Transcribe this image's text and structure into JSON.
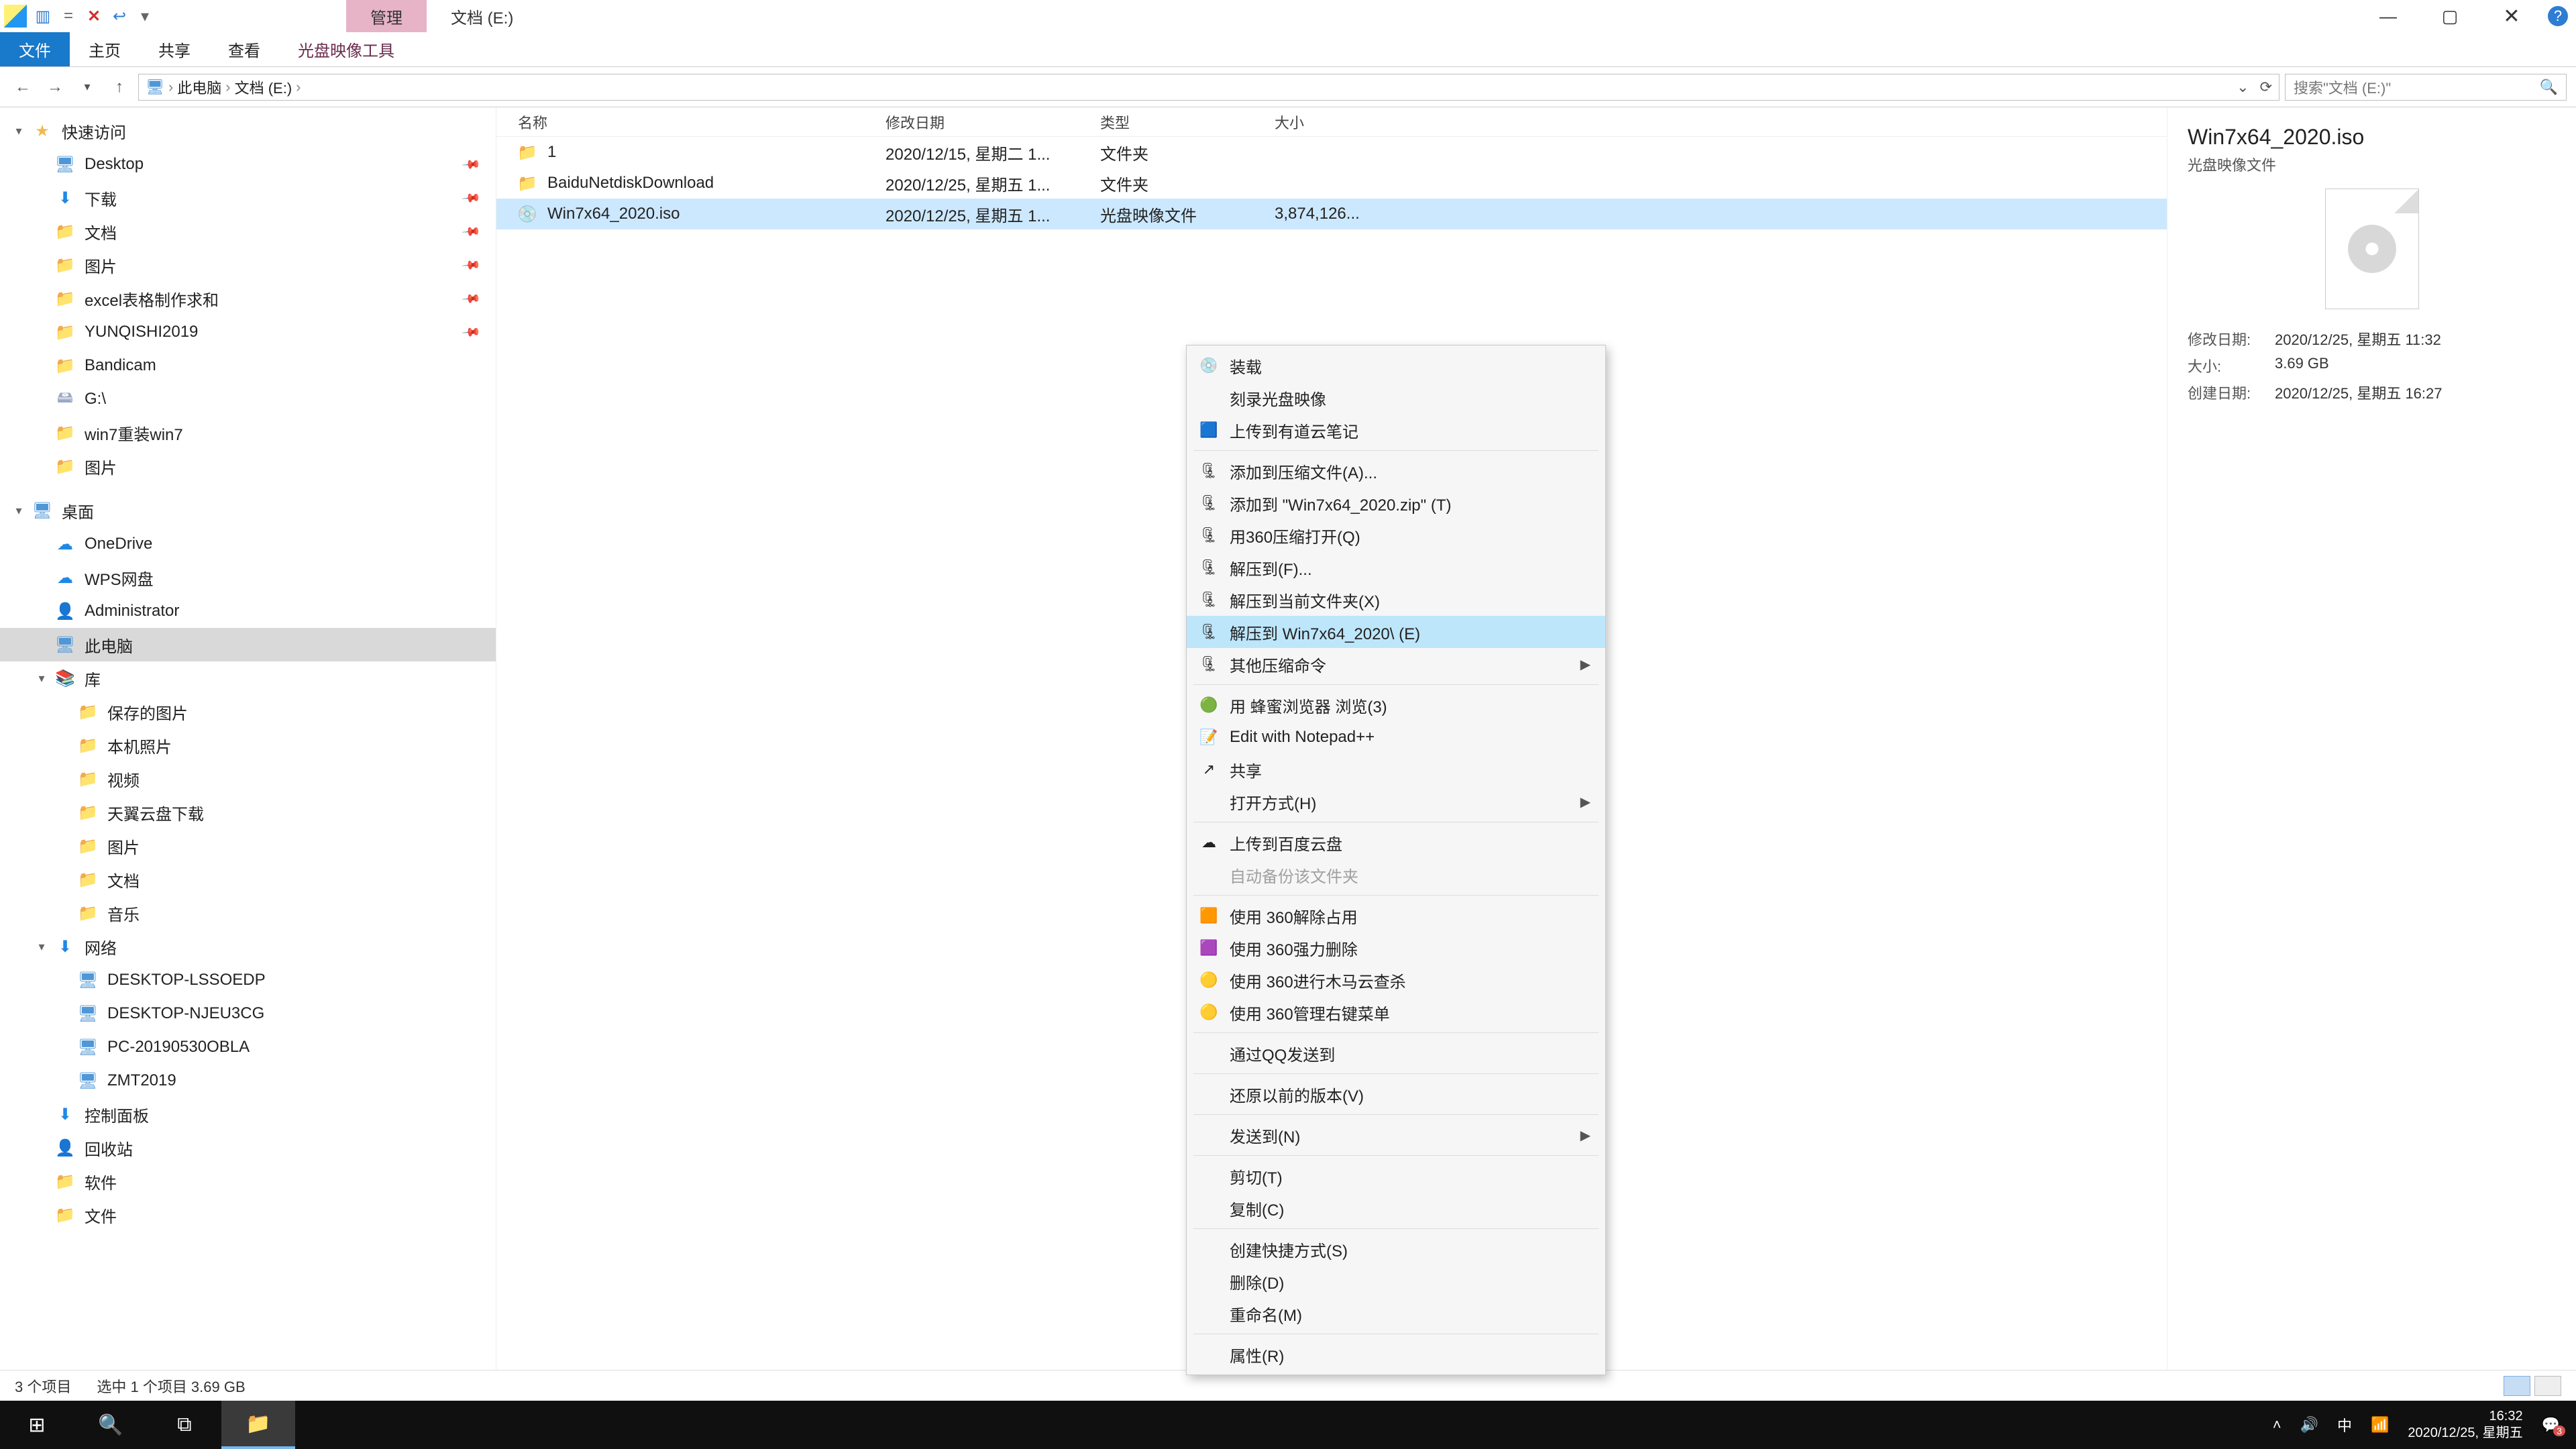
{
  "window": {
    "title_tabs": {
      "manage": "管理",
      "loc": "文档 (E:)"
    },
    "controls": {
      "min": "—",
      "max": "▢",
      "close": "✕",
      "help": "?"
    }
  },
  "qat": {
    "save_x": "✕",
    "undo": "↩",
    "redo": "▾",
    "eq": "="
  },
  "ribbon": {
    "file_tab": "文件",
    "tabs": [
      "主页",
      "共享",
      "查看"
    ],
    "contextual": "光盘映像工具"
  },
  "nav": {
    "back": "←",
    "fwd": "→",
    "recent": "▾",
    "up": "↑",
    "crumbs": [
      "此电脑",
      "文档 (E:)"
    ],
    "addr_chev": "›",
    "refresh": "⟳",
    "search_placeholder": "搜索\"文档 (E:)\"",
    "search_icon": "🔍"
  },
  "sidebar": [
    {
      "d": 0,
      "icon": "star",
      "label": "快速访问",
      "exp": "▾"
    },
    {
      "d": 1,
      "icon": "screen",
      "label": "Desktop",
      "pin": true
    },
    {
      "d": 1,
      "icon": "blue",
      "label": "下载",
      "pin": true
    },
    {
      "d": 1,
      "icon": "folder",
      "label": "文档",
      "pin": true
    },
    {
      "d": 1,
      "icon": "folder",
      "label": "图片",
      "pin": true
    },
    {
      "d": 1,
      "icon": "folder",
      "label": "excel表格制作求和",
      "pin": true
    },
    {
      "d": 1,
      "icon": "folder",
      "label": "YUNQISHI2019",
      "pin": true
    },
    {
      "d": 1,
      "icon": "folder",
      "label": "Bandicam"
    },
    {
      "d": 1,
      "icon": "drive",
      "label": "G:\\"
    },
    {
      "d": 1,
      "icon": "folder",
      "label": "win7重装win7"
    },
    {
      "d": 1,
      "icon": "folder",
      "label": "图片"
    },
    {
      "d": 0,
      "icon": "screen",
      "label": "桌面",
      "exp": "▾",
      "mtop": true
    },
    {
      "d": 1,
      "icon": "cloud",
      "label": "OneDrive"
    },
    {
      "d": 1,
      "icon": "cloud",
      "label": "WPS网盘"
    },
    {
      "d": 1,
      "icon": "grey",
      "label": "Administrator"
    },
    {
      "d": 1,
      "icon": "screen",
      "label": "此电脑",
      "sel": true
    },
    {
      "d": 1,
      "icon": "green",
      "label": "库",
      "exp": "▾"
    },
    {
      "d": 2,
      "icon": "folder",
      "label": "保存的图片"
    },
    {
      "d": 2,
      "icon": "folder",
      "label": "本机照片"
    },
    {
      "d": 2,
      "icon": "folder",
      "label": "视频"
    },
    {
      "d": 2,
      "icon": "folder",
      "label": "天翼云盘下载"
    },
    {
      "d": 2,
      "icon": "folder",
      "label": "图片"
    },
    {
      "d": 2,
      "icon": "folder",
      "label": "文档"
    },
    {
      "d": 2,
      "icon": "folder",
      "label": "音乐"
    },
    {
      "d": 1,
      "icon": "blue",
      "label": "网络",
      "exp": "▾"
    },
    {
      "d": 2,
      "icon": "screen",
      "label": "DESKTOP-LSSOEDP"
    },
    {
      "d": 2,
      "icon": "screen",
      "label": "DESKTOP-NJEU3CG"
    },
    {
      "d": 2,
      "icon": "screen",
      "label": "PC-20190530OBLA"
    },
    {
      "d": 2,
      "icon": "screen",
      "label": "ZMT2019"
    },
    {
      "d": 1,
      "icon": "blue",
      "label": "控制面板"
    },
    {
      "d": 1,
      "icon": "grey",
      "label": "回收站"
    },
    {
      "d": 1,
      "icon": "folder",
      "label": "软件"
    },
    {
      "d": 1,
      "icon": "folder",
      "label": "文件"
    }
  ],
  "cols": {
    "name": "名称",
    "date": "修改日期",
    "type": "类型",
    "size": "大小"
  },
  "rows": [
    {
      "icon": "folder",
      "name": "1",
      "date": "2020/12/15, 星期二 1...",
      "type": "文件夹",
      "size": ""
    },
    {
      "icon": "folder",
      "name": "BaiduNetdiskDownload",
      "date": "2020/12/25, 星期五 1...",
      "type": "文件夹",
      "size": ""
    },
    {
      "icon": "iso",
      "name": "Win7x64_2020.iso",
      "date": "2020/12/25, 星期五 1...",
      "type": "光盘映像文件",
      "size": "3,874,126...",
      "sel": true
    }
  ],
  "details": {
    "title": "Win7x64_2020.iso",
    "sub": "光盘映像文件",
    "mdate_k": "修改日期:",
    "mdate_v": "2020/12/25, 星期五 11:32",
    "size_k": "大小:",
    "size_v": "3.69 GB",
    "cdate_k": "创建日期:",
    "cdate_v": "2020/12/25, 星期五 16:27"
  },
  "ctx": [
    {
      "t": "装载",
      "ico": "disc"
    },
    {
      "t": "刻录光盘映像"
    },
    {
      "t": "上传到有道云笔记",
      "ico": "blue"
    },
    {
      "sep": true
    },
    {
      "t": "添加到压缩文件(A)...",
      "ico": "zip"
    },
    {
      "t": "添加到 \"Win7x64_2020.zip\" (T)",
      "ico": "zip"
    },
    {
      "t": "用360压缩打开(Q)",
      "ico": "zip"
    },
    {
      "t": "解压到(F)...",
      "ico": "zip"
    },
    {
      "t": "解压到当前文件夹(X)",
      "ico": "zip"
    },
    {
      "t": "解压到 Win7x64_2020\\ (E)",
      "ico": "zip",
      "hover": true
    },
    {
      "t": "其他压缩命令",
      "ico": "zip",
      "sub": true
    },
    {
      "sep": true
    },
    {
      "t": "用 蜂蜜浏览器 浏览(3)",
      "ico": "green"
    },
    {
      "t": "Edit with Notepad++",
      "ico": "npp"
    },
    {
      "t": "共享",
      "ico": "share"
    },
    {
      "t": "打开方式(H)",
      "sub": true
    },
    {
      "sep": true
    },
    {
      "t": "上传到百度云盘",
      "ico": "cloud"
    },
    {
      "t": "自动备份该文件夹",
      "disabled": true
    },
    {
      "sep": true
    },
    {
      "t": "使用 360解除占用",
      "ico": "sq"
    },
    {
      "t": "使用 360强力删除",
      "ico": "sq2"
    },
    {
      "t": "使用 360进行木马云查杀",
      "ico": "ball"
    },
    {
      "t": "使用 360管理右键菜单",
      "ico": "ball"
    },
    {
      "sep": true
    },
    {
      "t": "通过QQ发送到"
    },
    {
      "sep": true
    },
    {
      "t": "还原以前的版本(V)"
    },
    {
      "sep": true
    },
    {
      "t": "发送到(N)",
      "sub": true
    },
    {
      "sep": true
    },
    {
      "t": "剪切(T)"
    },
    {
      "t": "复制(C)"
    },
    {
      "sep": true
    },
    {
      "t": "创建快捷方式(S)"
    },
    {
      "t": "删除(D)"
    },
    {
      "t": "重命名(M)"
    },
    {
      "sep": true
    },
    {
      "t": "属性(R)"
    }
  ],
  "status": {
    "count": "3 个项目",
    "sel": "选中 1 个项目  3.69 GB"
  },
  "taskbar": {
    "start": "⊞",
    "search": "🔍",
    "taskview": "⧉",
    "explorer": "📁",
    "tray_up": "˄",
    "vol": "🔊",
    "ime": "中",
    "net": "📶",
    "msg": "💬",
    "msg_badge": "3",
    "time": "16:32",
    "date": "2020/12/25, 星期五"
  }
}
